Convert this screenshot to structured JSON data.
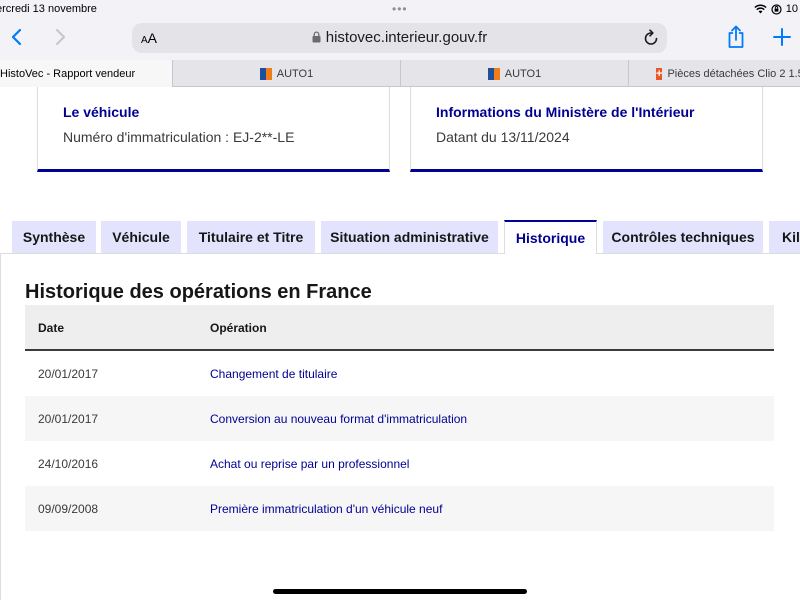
{
  "status_bar": {
    "date": "ercredi 13 novembre",
    "dots": "•••",
    "battery_text": "10"
  },
  "toolbar": {
    "reader_label_small": "A",
    "reader_label_big": "A",
    "url": "histovec.interieur.gouv.fr"
  },
  "browser_tabs": [
    {
      "label": "HistoVec - Rapport vendeur",
      "favicon": "none",
      "active": true
    },
    {
      "label": "AUTO1",
      "favicon": "auto1-logo",
      "active": false
    },
    {
      "label": "AUTO1",
      "favicon": "auto1-logo",
      "active": false
    },
    {
      "label": "Pièces détachées Clio 2 1.5",
      "favicon": "pieces-plus-logo",
      "active": false
    }
  ],
  "cards": [
    {
      "title": "Le véhicule",
      "text": "Numéro d'immatriculation : EJ-2**-LE"
    },
    {
      "title": "Informations du Ministère de l'Intérieur",
      "text": "Datant du 13/11/2024"
    }
  ],
  "section_tabs": [
    {
      "label": "Synthèse",
      "active": false
    },
    {
      "label": "Véhicule",
      "active": false
    },
    {
      "label": "Titulaire et Titre",
      "active": false
    },
    {
      "label": "Situation administrative",
      "active": false
    },
    {
      "label": "Historique",
      "active": true
    },
    {
      "label": "Contrôles techniques",
      "active": false
    },
    {
      "label": "Kil",
      "active": false
    }
  ],
  "history": {
    "title": "Historique des opérations en France",
    "columns": [
      "Date",
      "Opération"
    ],
    "rows": [
      {
        "date": "20/01/2017",
        "operation": "Changement de titulaire"
      },
      {
        "date": "20/01/2017",
        "operation": "Conversion au nouveau format d'immatriculation"
      },
      {
        "date": "24/10/2016",
        "operation": "Achat ou reprise par un professionnel"
      },
      {
        "date": "09/09/2008",
        "operation": "Première immatriculation d'un véhicule neuf"
      }
    ]
  },
  "colors": {
    "accent": "#000091",
    "tab_bg": "#e3e3fd",
    "header_bg": "#eeeeee",
    "row_alt": "#f6f6f6"
  }
}
